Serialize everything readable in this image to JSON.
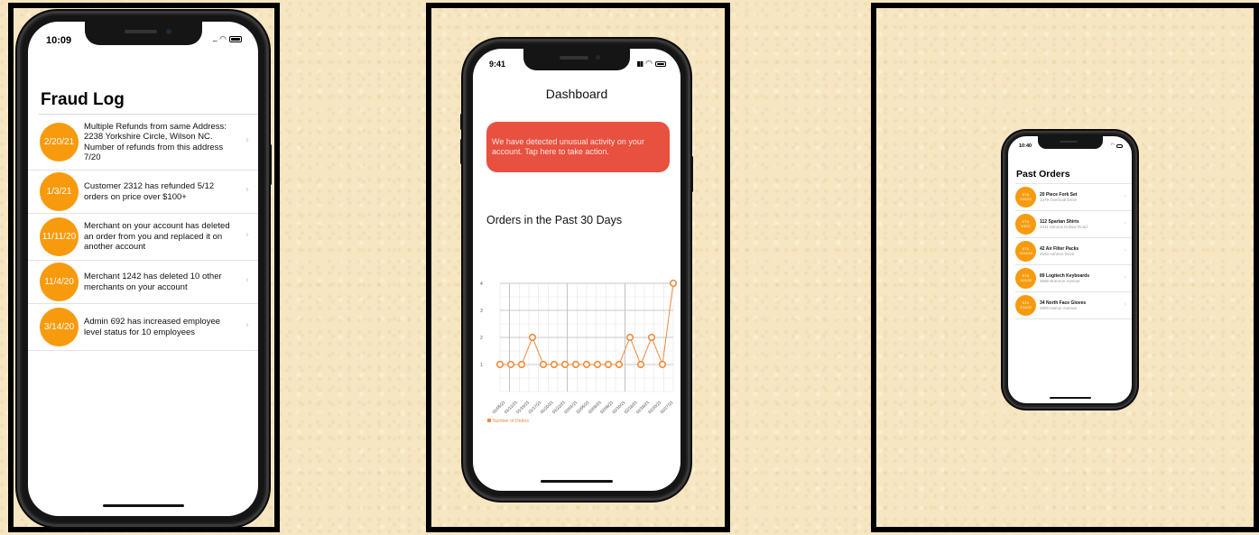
{
  "phone1": {
    "time": "10:09",
    "title": "Fraud Log",
    "items": [
      {
        "badge": "2/20/21",
        "text": "Multiple Refunds from same Address: 2238 Yorkshire Circle, Wilson NC. Number of refunds from this address 7/20"
      },
      {
        "badge": "1/3/21",
        "text": "Customer 2312 has refunded 5/12 orders on price over $100+"
      },
      {
        "badge": "11/11/20",
        "text": "Merchant on your account has deleted an order from you and replaced it on another account"
      },
      {
        "badge": "11/4/20",
        "text": "Merchant 1242 has deleted 10 other merchants on your account"
      },
      {
        "badge": "3/14/20",
        "text": "Admin 692 has increased employee level status for 10 employees"
      }
    ]
  },
  "phone2": {
    "time": "9:41",
    "title": "Dashboard",
    "alert": "We have detected unusual activity on your account. Tap here to take action.",
    "chart_heading": "Orders in the Past 30 Days"
  },
  "chart_data": {
    "type": "line",
    "title": "",
    "xlabel": "",
    "ylabel": "",
    "ylim": [
      0,
      4
    ],
    "yticks": [
      1,
      2,
      3,
      4
    ],
    "x_tick_labels": [
      "01/05/21",
      "01/12/21",
      "01/15/21",
      "01/17/21",
      "01/20/21",
      "01/22/21",
      "02/01/21",
      "02/05/21",
      "02/06/21",
      "02/08/21",
      "02/10/21",
      "02/16/21",
      "02/18/21",
      "02/20/21",
      "02/27/21"
    ],
    "series": [
      {
        "name": "Number of Orders",
        "color": "#f08a3c",
        "points": [
          {
            "x": 0,
            "y": 1
          },
          {
            "x": 1,
            "y": 1
          },
          {
            "x": 2,
            "y": 1
          },
          {
            "x": 3,
            "y": 2
          },
          {
            "x": 4,
            "y": 1
          },
          {
            "x": 5,
            "y": 1
          },
          {
            "x": 6,
            "y": 1
          },
          {
            "x": 7,
            "y": 1
          },
          {
            "x": 8,
            "y": 1
          },
          {
            "x": 9,
            "y": 1
          },
          {
            "x": 10,
            "y": 1
          },
          {
            "x": 11,
            "y": 1
          },
          {
            "x": 12,
            "y": 2
          },
          {
            "x": 13,
            "y": 1
          },
          {
            "x": 14,
            "y": 2
          },
          {
            "x": 15,
            "y": 1
          },
          {
            "x": 16,
            "y": 4
          }
        ]
      }
    ],
    "grid": true,
    "legend": "bottom-left"
  },
  "phone3": {
    "time": "10:40",
    "title": "Past Orders",
    "items": [
      {
        "eta": "ETA",
        "date": "2/20/21",
        "title": "20 Piece Fork Set",
        "address": "1479 Overlook Drive"
      },
      {
        "eta": "ETA",
        "date": "1/3/21",
        "title": "112 Spartan Shirts",
        "address": "2311 Simons Hollow Road"
      },
      {
        "eta": "ETA",
        "date": "11/11/20",
        "title": "42 Air Filter Packs",
        "address": "4540 Ashmor Drive"
      },
      {
        "eta": "ETA",
        "date": "11/4/20",
        "title": "89 Logitech Keyboards",
        "address": "3686 Brannon Avenue"
      },
      {
        "eta": "ETA",
        "date": "3/14/20",
        "title": "34 North Face Gloves",
        "address": "4800 Hamor Avenue"
      }
    ]
  }
}
